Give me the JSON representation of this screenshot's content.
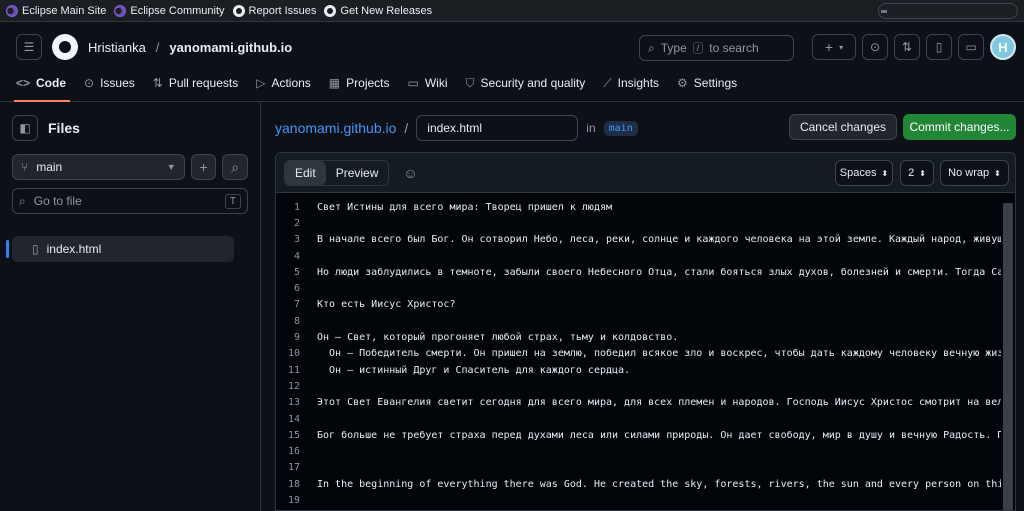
{
  "bookmarks": [
    {
      "label": "Eclipse Main Site",
      "icon": "eclipse-icon"
    },
    {
      "label": "Eclipse Community",
      "icon": "eclipse-icon"
    },
    {
      "label": "Report Issues",
      "icon": "github-icon"
    },
    {
      "label": "Get New Releases",
      "icon": "github-icon"
    }
  ],
  "header": {
    "owner": "Hristianka",
    "separator": "/",
    "repo": "yanomami.github.io",
    "search_prefix": "Type",
    "search_key": "/",
    "search_suffix": "to search",
    "avatar_letter": "H"
  },
  "tabs": [
    {
      "label": "Code",
      "icon": "<>"
    },
    {
      "label": "Issues",
      "icon": "⊙"
    },
    {
      "label": "Pull requests",
      "icon": "⇅"
    },
    {
      "label": "Actions",
      "icon": "▷"
    },
    {
      "label": "Projects",
      "icon": "▦"
    },
    {
      "label": "Wiki",
      "icon": "▭"
    },
    {
      "label": "Security and quality",
      "icon": "⛉"
    },
    {
      "label": "Insights",
      "icon": "⟋"
    },
    {
      "label": "Settings",
      "icon": "⚙"
    }
  ],
  "sidebar": {
    "title": "Files",
    "branch": "main",
    "goto_placeholder": "Go to file",
    "goto_key": "T",
    "tree": [
      {
        "name": "index.html"
      }
    ]
  },
  "editor": {
    "repo_link": "yanomami.github.io",
    "slash": "/",
    "filename": "index.html",
    "in_label": "in",
    "branch": "main",
    "cancel_label": "Cancel changes",
    "commit_label": "Commit changes...",
    "edit_label": "Edit",
    "preview_label": "Preview",
    "indent_mode": "Spaces",
    "indent_size": "2",
    "wrap_mode": "No wrap",
    "lines": [
      "Свет Истины для всего мира: Творец пришел к людям",
      "",
      "В начале всего был Бог. Он сотворил Небо, леса, реки, солнце и каждого человека на этой земле. Каждый народ, живущий в б",
      "",
      "Но люди заблудились в темноте, забыли своего Небесного Отца, стали бояться злых духов, болезней и смерти. Тогда Сам Бог",
      "",
      "Кто есть Иисус Христос?",
      "",
      "Он — Свет, который прогоняет любой страх, тьму и колдовство.",
      "  Он — Победитель смерти. Он пришел на землю, победил всякое зло и воскрес, чтобы дать каждому человеку вечную жизнь.",
      "  Он — истинный Друг и Спаситель для каждого сердца.",
      "",
      "Этот Свет Евангелия светит сегодня для всего мира, для всех племен и народов. Господь Иисус Христос смотрит на великие л",
      "",
      "Бог больше не требует страха перед духами леса или силами природы. Он дает свободу, мир в душу и вечную Радость. Примите",
      "",
      "",
      "In the beginning of everything there was God. He created the sky, forests, rivers, the sun and every person on this eart",
      ""
    ]
  },
  "colors": {
    "accent_link": "#4493f8",
    "commit_green": "#238636",
    "active_tab_underline": "#f78166"
  }
}
